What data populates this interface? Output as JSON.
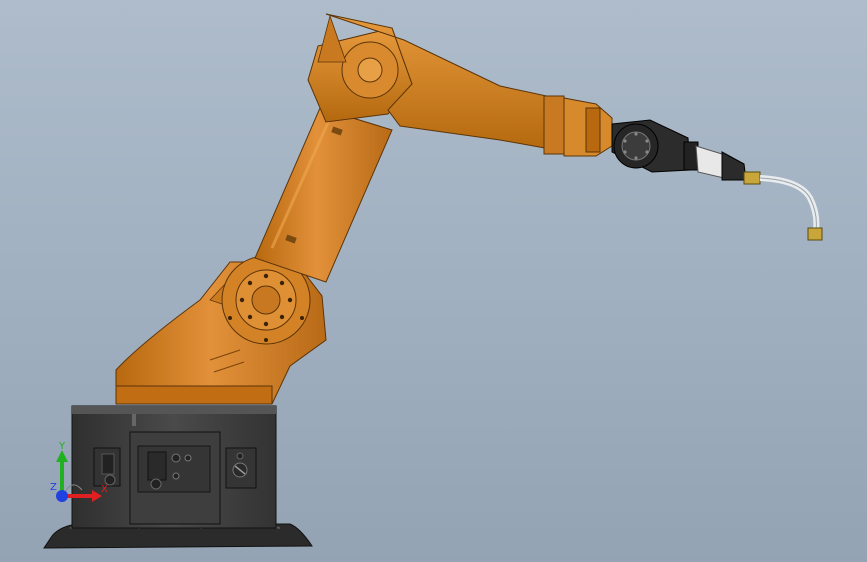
{
  "viewport": {
    "background_top": "#aebccb",
    "background_bottom": "#93a3b3"
  },
  "colors": {
    "robot_orange": "#d57f1f",
    "robot_orange_light": "#e79a3c",
    "robot_orange_dark": "#a85e12",
    "base_dark": "#3a3a3a",
    "base_mid": "#4b4b4b",
    "wrist_dark": "#2c2c2c",
    "cable_white": "#e8ecef",
    "torch_gold": "#c8a63a",
    "axis_x": "#e02020",
    "axis_y": "#20b020",
    "axis_z": "#2040e0"
  },
  "triad": {
    "x_label": "X",
    "y_label": "Y",
    "z_label": "Z"
  }
}
